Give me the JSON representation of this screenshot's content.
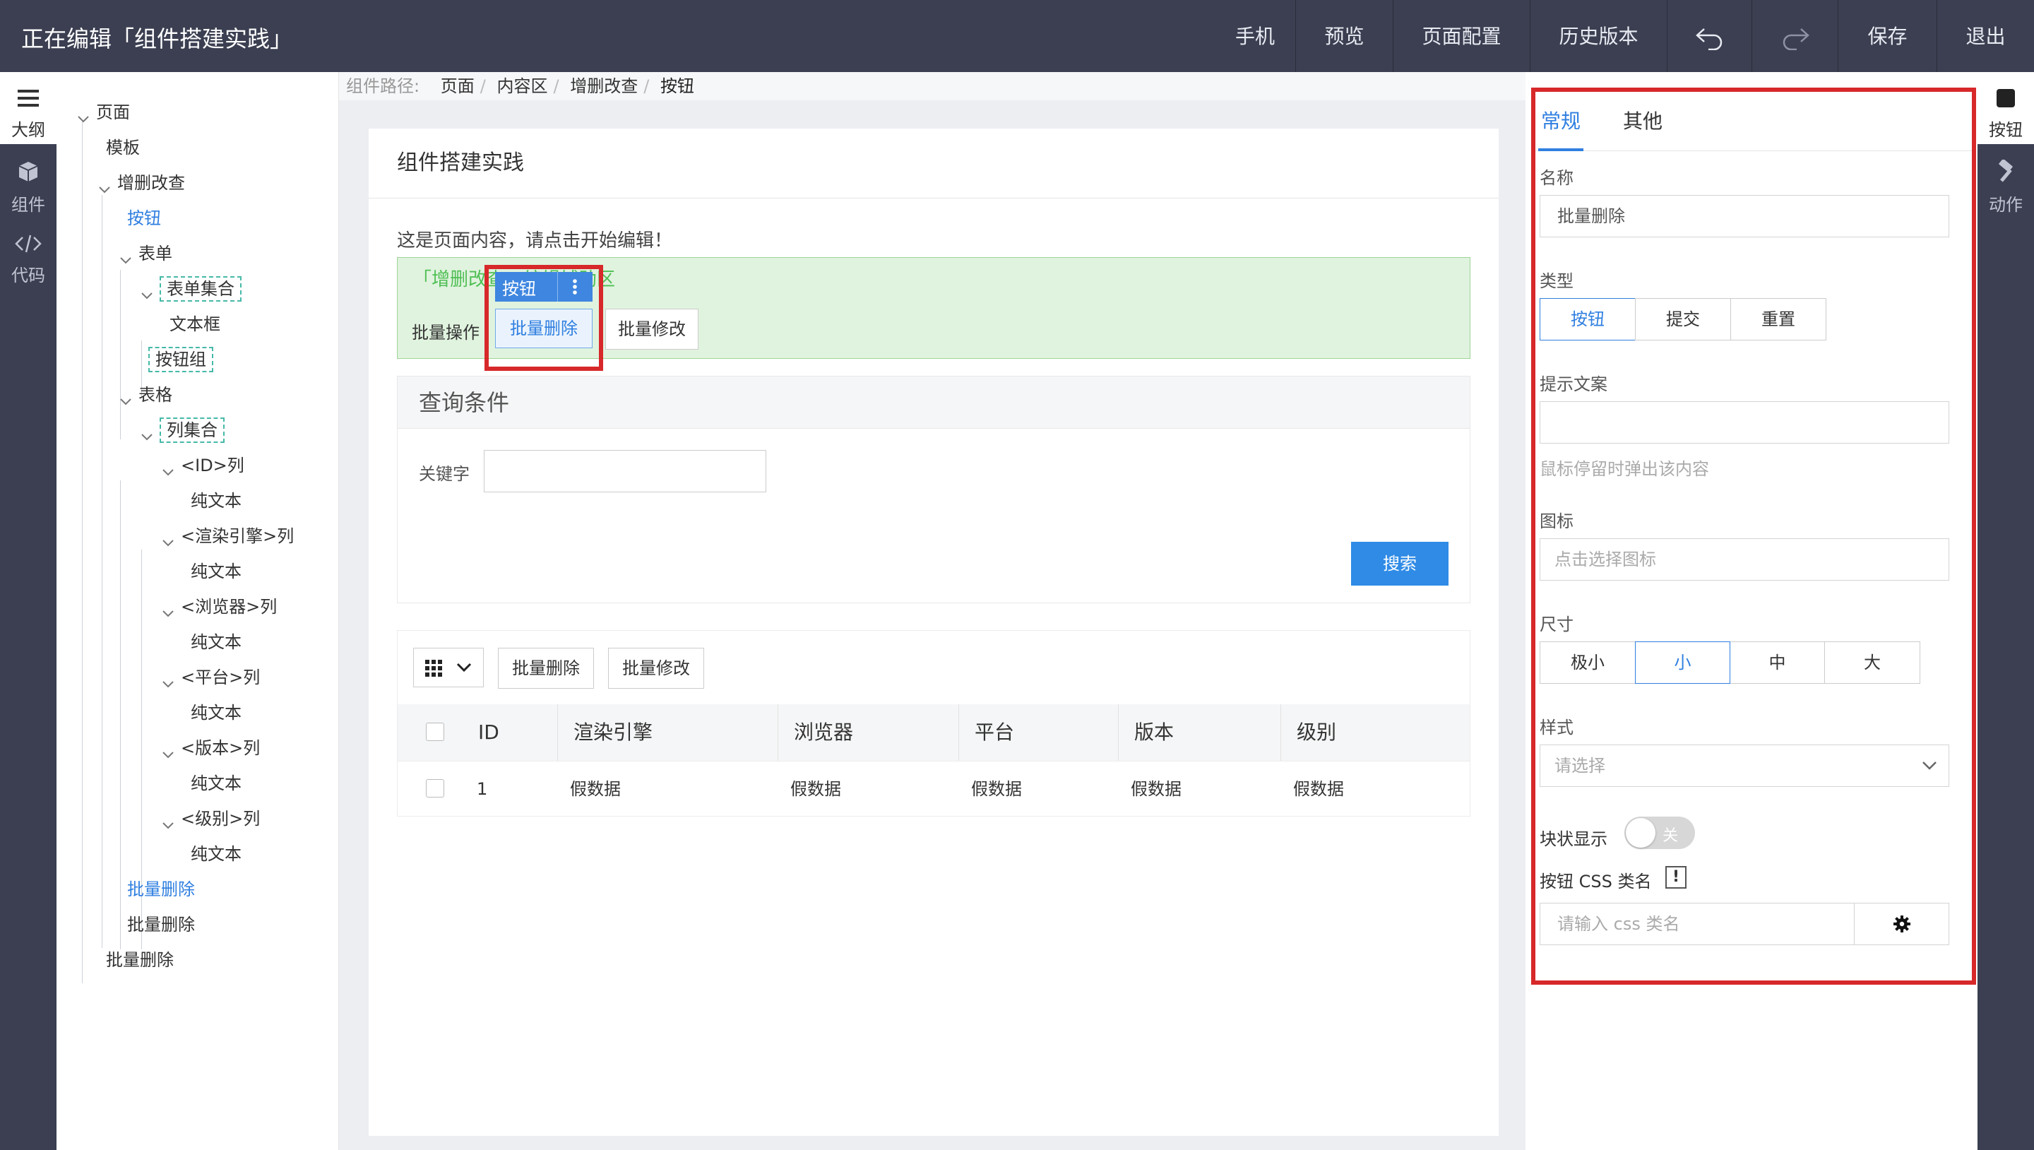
{
  "app": {
    "title": "正在编辑「组件搭建实践」"
  },
  "topbar": {
    "mobile": "手机",
    "preview": "预览",
    "page_config": "页面配置",
    "history": "历史版本",
    "undo_icon": "undo-icon",
    "redo_icon": "redo-icon",
    "save": "保存",
    "exit": "退出"
  },
  "leftrail": {
    "outline": "大纲",
    "components": "组件",
    "code": "代码"
  },
  "outline": {
    "items": [
      {
        "label": "页面",
        "depth": 0,
        "expandable": true
      },
      {
        "label": "模板",
        "depth": 1,
        "expandable": false
      },
      {
        "label": "增删改查",
        "depth": 1,
        "expandable": true
      },
      {
        "label": "按钮",
        "depth": 2,
        "expandable": false,
        "active": true
      },
      {
        "label": "表单",
        "depth": 2,
        "expandable": true
      },
      {
        "label": "表单集合",
        "depth": 3,
        "expandable": true,
        "dashed": true
      },
      {
        "label": "文本框",
        "depth": 4,
        "expandable": false
      },
      {
        "label": "按钮组",
        "depth": 3,
        "expandable": false,
        "dashed": true
      },
      {
        "label": "表格",
        "depth": 2,
        "expandable": true
      },
      {
        "label": "列集合",
        "depth": 3,
        "expandable": true,
        "dashed": true
      },
      {
        "label": "<ID>列",
        "depth": 4,
        "expandable": true
      },
      {
        "label": "纯文本",
        "depth": 5,
        "expandable": false
      },
      {
        "label": "<渲染引擎>列",
        "depth": 4,
        "expandable": true
      },
      {
        "label": "纯文本",
        "depth": 5,
        "expandable": false
      },
      {
        "label": "<浏览器>列",
        "depth": 4,
        "expandable": true
      },
      {
        "label": "纯文本",
        "depth": 5,
        "expandable": false
      },
      {
        "label": "<平台>列",
        "depth": 4,
        "expandable": true
      },
      {
        "label": "纯文本",
        "depth": 5,
        "expandable": false
      },
      {
        "label": "<版本>列",
        "depth": 4,
        "expandable": true
      },
      {
        "label": "纯文本",
        "depth": 5,
        "expandable": false
      },
      {
        "label": "<级别>列",
        "depth": 4,
        "expandable": true
      },
      {
        "label": "纯文本",
        "depth": 5,
        "expandable": false
      },
      {
        "label": "批量删除",
        "depth": 2,
        "expandable": false,
        "active": true
      },
      {
        "label": "批量删除",
        "depth": 2,
        "expandable": false
      },
      {
        "label": "批量删除",
        "depth": 1,
        "expandable": false
      }
    ]
  },
  "breadcrumb": {
    "prefix": "组件路径:",
    "items": [
      "页面",
      "内容区",
      "增删改查",
      "按钮"
    ]
  },
  "page": {
    "heading": "组件搭建实践",
    "intro": "这是页面内容，请点击开始编辑！",
    "zone_label": "「增删改查」编辑辅助区",
    "batch_ops_label": "批量操作",
    "selected_button": "批量删除",
    "selected_tag": "按钮",
    "batch_edit_button": "批量修改"
  },
  "query": {
    "title": "查询条件",
    "keyword_label": "关键字",
    "keyword_value": "",
    "search_button": "搜索"
  },
  "table": {
    "toolbar": {
      "delete": "批量删除",
      "edit": "批量修改"
    },
    "columns": [
      "ID",
      "渲染引擎",
      "浏览器",
      "平台",
      "版本",
      "级别"
    ],
    "rows": [
      [
        "1",
        "假数据",
        "假数据",
        "假数据",
        "假数据",
        "假数据"
      ]
    ]
  },
  "config": {
    "tabs": [
      "常规",
      "其他"
    ],
    "active_tab": "常规",
    "name_label": "名称",
    "name_value": "批量删除",
    "type_label": "类型",
    "type_options": [
      "按钮",
      "提交",
      "重置"
    ],
    "type_selected": "按钮",
    "tooltip_label": "提示文案",
    "tooltip_value": "",
    "tooltip_hint": "鼠标停留时弹出该内容",
    "icon_label": "图标",
    "icon_placeholder": "点击选择图标",
    "size_label": "尺寸",
    "size_options": [
      "极小",
      "小",
      "中",
      "大"
    ],
    "size_selected": "小",
    "style_label": "样式",
    "style_placeholder": "请选择",
    "block_label": "块状显示",
    "block_toggle": "关",
    "css_label": "按钮 CSS 类名",
    "css_placeholder": "请输入 css 类名",
    "accent_color": "#2f7fe0",
    "highlight_color": "#d7282a"
  },
  "rightrail": {
    "button": "按钮",
    "action": "动作"
  }
}
